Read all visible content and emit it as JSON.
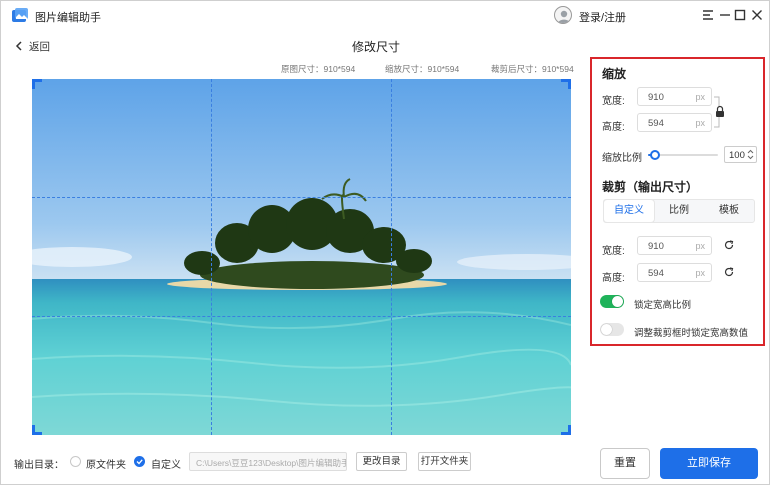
{
  "app": {
    "title": "图片编辑助手",
    "login_label": "登录/注册"
  },
  "header": {
    "back_label": "返回",
    "page_title": "修改尺寸",
    "original_size": "原图尺寸：910*594",
    "scaled_size": "缩放尺寸：910*594",
    "cropped_size": "裁剪后尺寸：910*594"
  },
  "panel": {
    "scale": {
      "title": "缩放",
      "width_label": "宽度:",
      "width_value": "910",
      "height_label": "高度:",
      "height_value": "594",
      "unit": "px",
      "ratio_label": "缩放比例",
      "ratio_value": "100",
      "ratio_slider_fraction": 0.1
    },
    "crop": {
      "title": "裁剪（输出尺寸）",
      "tabs": [
        "自定义",
        "比例",
        "模板"
      ],
      "active_tab": "自定义",
      "width_label": "宽度:",
      "width_value": "910",
      "height_label": "高度:",
      "height_value": "594",
      "unit": "px"
    },
    "toggles": [
      {
        "label": "锁定宽高比例",
        "on": true
      },
      {
        "label": "调整裁剪框时锁定宽高数值",
        "on": false
      }
    ]
  },
  "bottom": {
    "output_label": "输出目录：",
    "option_original": "原文件夹",
    "option_custom": "自定义",
    "selected_option": "自定义",
    "path_value": "C:\\Users\\豆豆123\\Desktop\\图片编辑助手",
    "change_dir_label": "更改目录",
    "open_folder_label": "打开文件夹",
    "reset_label": "重置",
    "save_label": "立即保存"
  },
  "colors": {
    "accent": "#1e6fe8",
    "highlight_border": "#d9262b",
    "toggle_on": "#1fb35a"
  },
  "icons": [
    "app-logo-icon",
    "avatar-icon",
    "menu-icon",
    "minimize-icon",
    "maximize-icon",
    "close-icon",
    "back-arrow-icon",
    "lock-icon",
    "refresh-icon",
    "stepper-icon",
    "check-icon"
  ]
}
